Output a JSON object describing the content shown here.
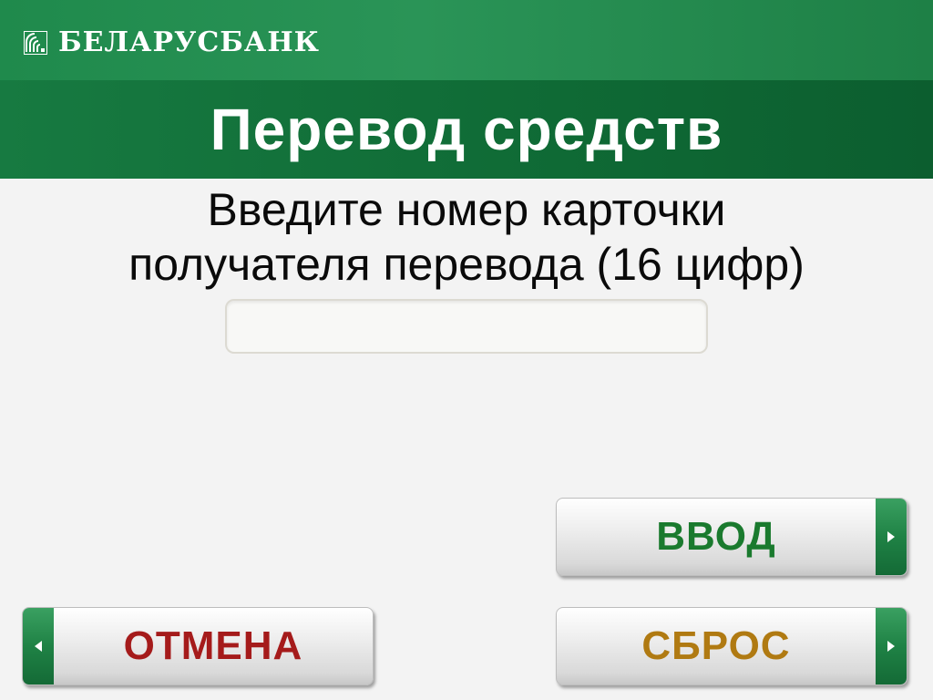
{
  "brand": {
    "name": "БЕЛАРУСБАНК",
    "logo_icon": "belarusbank-logo-icon"
  },
  "screen": {
    "title": "Перевод средств",
    "prompt_line1": "Введите номер карточки",
    "prompt_line2": "получателя перевода (16 цифр)"
  },
  "card_input": {
    "value": "",
    "placeholder": ""
  },
  "buttons": {
    "enter": "ВВОД",
    "reset": "СБРОС",
    "cancel": "ОТМЕНА"
  },
  "colors": {
    "brand_green": "#1f8a4c",
    "title_green": "#0f6a35",
    "enter_text": "#1a7a2e",
    "reset_text": "#b07a12",
    "cancel_text": "#a51b1b"
  }
}
